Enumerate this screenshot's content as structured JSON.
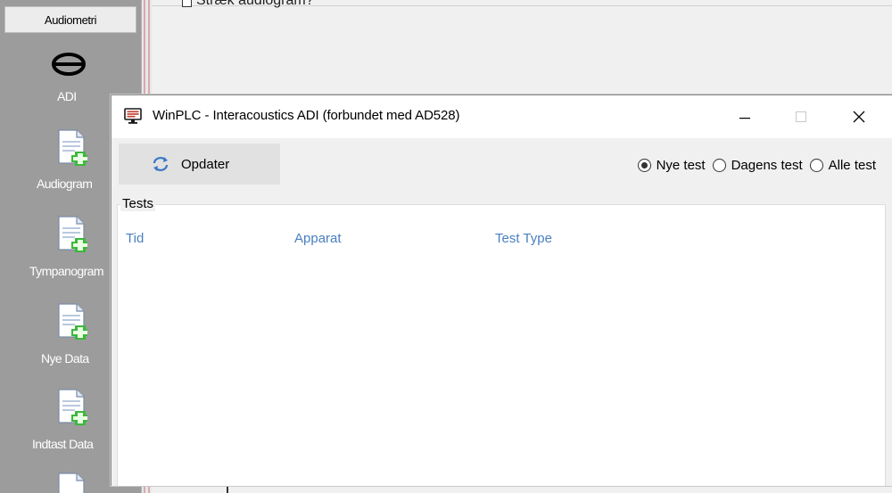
{
  "background_app": {
    "sidebar_header": "Audiometri",
    "sidebar_items": [
      {
        "label": "ADI",
        "icon": "adi-logo-icon"
      },
      {
        "label": "Audiogram",
        "icon": "new-document-icon"
      },
      {
        "label": "Tympanogram",
        "icon": "new-document-icon"
      },
      {
        "label": "Nye Data",
        "icon": "new-document-icon"
      },
      {
        "label": "Indtast Data",
        "icon": "new-document-icon"
      }
    ],
    "checkbox_label": "Stræk audiogram?"
  },
  "dialog": {
    "title": "WinPLC - Interacoustics ADI (forbundet med AD528)",
    "refresh_label": "Opdater",
    "radio_options": [
      {
        "label": "Nye test",
        "checked": true
      },
      {
        "label": "Dagens test",
        "checked": false
      },
      {
        "label": "Alle test",
        "checked": false
      }
    ],
    "group_title": "Tests",
    "columns": [
      "Tid",
      "Apparat",
      "Test Type"
    ],
    "rows": []
  },
  "colors": {
    "sidebar_bg": "#9c9c9c",
    "column_header": "#4a7fc0",
    "plus_green": "#3cb83c"
  }
}
